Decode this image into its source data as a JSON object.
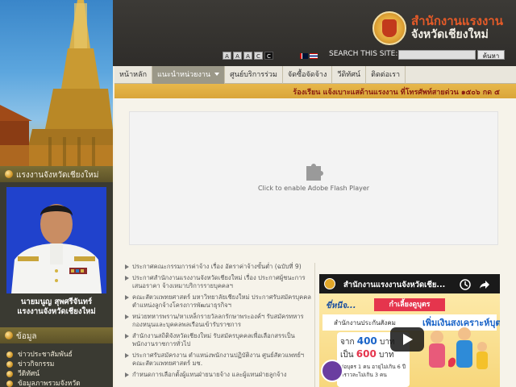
{
  "header": {
    "org_name": "สำนักงานแรงงาน",
    "org_province": "จังหวัดเชียงใหม่",
    "font_size_buttons": [
      "A",
      "A",
      "A",
      "C",
      "C"
    ],
    "search_label": "SEARCH THIS SITE:",
    "search_value": "",
    "search_button": "ค้นหา"
  },
  "nav": {
    "items": [
      {
        "label": "หน้าหลัก"
      },
      {
        "label": "แนะนำหน่วยงาน"
      },
      {
        "label": "ศูนย์บริการร่วม"
      },
      {
        "label": "จัดซื้อจัดจ้าง"
      },
      {
        "label": "วีดิทัศน์"
      },
      {
        "label": "ติดต่อเรา"
      }
    ]
  },
  "marquee": {
    "text": "ร้องเรียน แจ้งเบาะแสด้านแรงงาน ที่โทรศัพท์สายด่วน ๑๕๐๖ กด ๕"
  },
  "flash": {
    "message": "Click to enable Adobe Flash Player"
  },
  "news": {
    "items": [
      "ประกาศคณะกรรมการค่าจ้าง เรื่อง อัตราค่าจ้างขั้นต่ำ (ฉบับที่ 9)",
      "ประกาศสำนักงานแรงงานจังหวัดเชียงใหม่ เรื่อง ประกาศผู้ชนะการเสนอราคา จ้างเหมาบริการรายบุคคลฯ",
      "คณะสัตวแพทยศาสตร์ มหาวิทยาลัยเชียงใหม่ ประกาศรับสมัครบุคคล ตำแหน่งลูกจ้างโครงการพัฒนาธุรกิจฯ",
      "หน่วยทหารพราน/หาเหล็กรายวัลลกรักษาพระองค์ฯ รับสมัครทหารกองหนุนและบุคคลพลเรือนเข้ารับราชการ",
      "สำนักงานสถิติจังหวัดเชียงใหม่ รับสมัครบุคคลเพื่อเลือกสรรเป็นพนักงานราชการทั่วไป",
      "ประกาศรับสมัครงาน ตำแหน่งพนักงานปฏิบัติงาน ศูนย์สัตวแพทย์ฯ คณะสัตวแพทยศาสตร์ มช.",
      "กำหนดการเลือกตั้งผู้แทนฝ่ายนายจ้าง และผู้แทนฝ่ายลูกจ้าง"
    ]
  },
  "video": {
    "title": "สำนักงานแรงงานจังหวัดเชีย...",
    "thumb_topline": "ขี่หนีจ...",
    "thumb_badge": "กำเลี้ยงดูบุตร",
    "thumb_subline": "สำนักงานประกันสังคม",
    "thumb_highlight": "เพิ่มเงินสงเคราะห์บุตร",
    "thumb_from_prefix": "จาก",
    "thumb_from_value": "400",
    "thumb_from_suffix": "บาท",
    "thumb_is_prefix": "เป็น",
    "thumb_is_value": "600",
    "thumb_is_suffix": "บาท",
    "thumb_cond1": "ต่อบุตร 1 คน อายุไม่เกิน 6 ปี",
    "thumb_cond2": "คราวละไม่เกิน 3 คน"
  },
  "sidebar": {
    "director_header": "แรงงานจังหวัดเชียงใหม่",
    "director_name": "นายมนูญ สุพศรีจันทร์",
    "director_title": "แรงงานจังหวัดเชียงใหม่",
    "info_header": "ข้อมูล",
    "links": [
      "ข่าวประชาสัมพันธ์",
      "ข่าวกิจกรรม",
      "วีดิทัศน์",
      "ข้อมูลภาพรวมจังหวัด"
    ]
  },
  "colors": {
    "accent_orange": "#e45a28",
    "marquee_gold": "#e0b045",
    "sidebar_dark": "#3a3a32"
  }
}
